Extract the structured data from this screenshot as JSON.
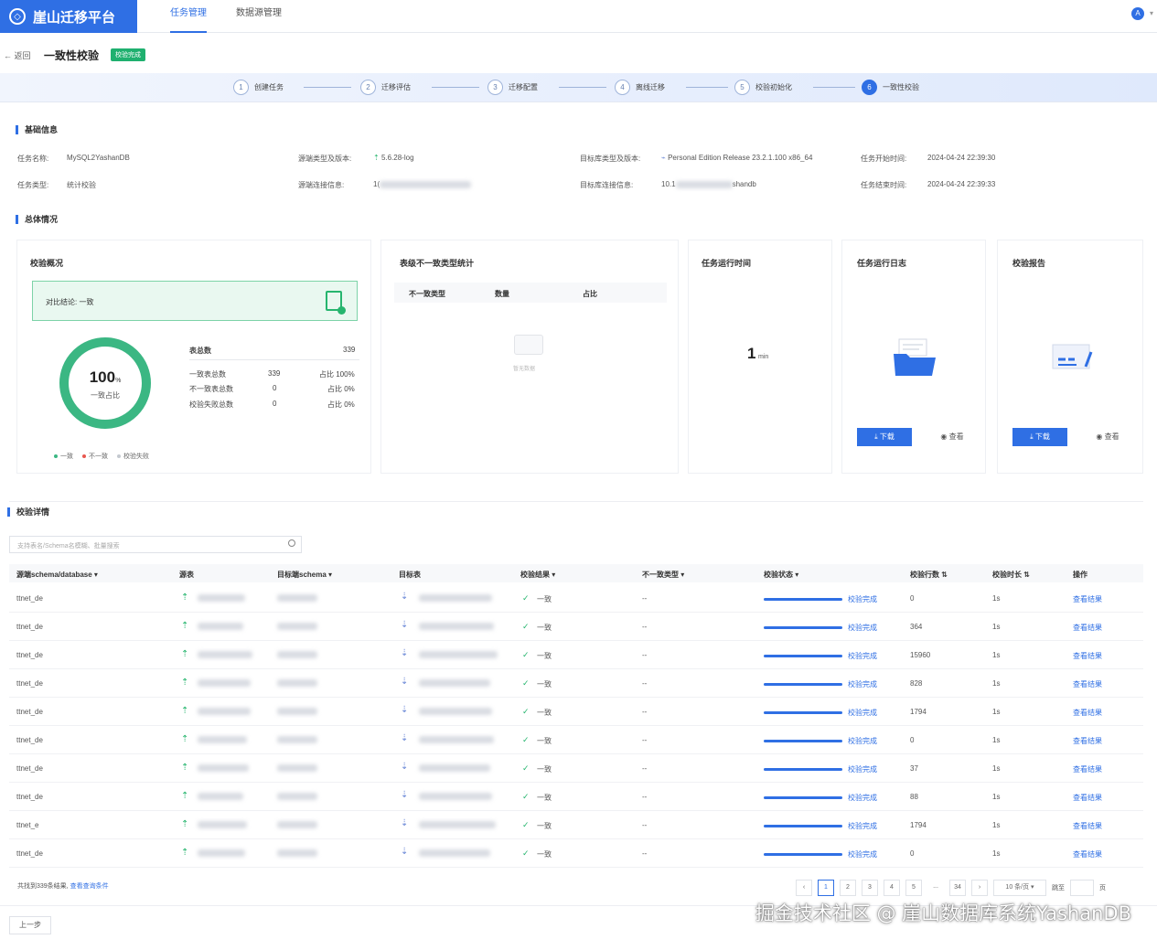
{
  "header": {
    "brand": "崖山迁移平台",
    "tabs": [
      "任务管理",
      "数据源管理"
    ],
    "avatar_letter": "A"
  },
  "subheader": {
    "back_label": "返回",
    "title": "一致性校验",
    "status": "校验完成"
  },
  "steps": [
    {
      "num": "1",
      "label": "创建任务"
    },
    {
      "num": "2",
      "label": "迁移评估"
    },
    {
      "num": "3",
      "label": "迁移配置"
    },
    {
      "num": "4",
      "label": "离线迁移"
    },
    {
      "num": "5",
      "label": "校验初始化"
    },
    {
      "num": "6",
      "label": "一致性校验"
    }
  ],
  "basic_info": {
    "title": "基础信息",
    "task_name_label": "任务名称:",
    "task_name": "MySQL2YashanDB",
    "task_type_label": "任务类型:",
    "task_type": "统计校验",
    "src_type_label": "源端类型及版本:",
    "src_version": "5.6.28-log",
    "src_conn_label": "源端连接信息:",
    "src_conn_prefix": "1(",
    "tgt_type_label": "目标库类型及版本:",
    "tgt_version": "Personal Edition Release 23.2.1.100 x86_64",
    "tgt_conn_label": "目标库连接信息:",
    "tgt_conn_prefix": "10.1",
    "tgt_conn_suffix": "shandb",
    "start_label": "任务开始时间:",
    "start_time": "2024-04-24 22:39:30",
    "end_label": "任务结束时间:",
    "end_time": "2024-04-24 22:39:33"
  },
  "overview": {
    "title": "总体情况",
    "summary_card": {
      "title": "校验概况",
      "conclusion": "对比结论: 一致",
      "percent": "100",
      "percent_unit": "%",
      "percent_label": "一致占比",
      "total_label": "表总数",
      "total": "339",
      "rows": [
        {
          "label": "一致表总数",
          "value": "339",
          "ratio": "占比 100%"
        },
        {
          "label": "不一致表总数",
          "value": "0",
          "ratio": "占比 0%"
        },
        {
          "label": "校验失败总数",
          "value": "0",
          "ratio": "占比 0%"
        }
      ],
      "legend": [
        "一致",
        "不一致",
        "校验失败"
      ],
      "consistent_fraction": 1.0
    },
    "inconsistency_card": {
      "title": "表级不一致类型统计",
      "columns": [
        "不一致类型",
        "数量",
        "占比"
      ],
      "empty": "暂无数据"
    },
    "runtime_card": {
      "title": "任务运行时间",
      "value": "1",
      "unit": "min"
    },
    "log_card": {
      "title": "任务运行日志",
      "download": "下载",
      "view": "查看"
    },
    "report_card": {
      "title": "校验报告",
      "download": "下载",
      "view": "查看"
    }
  },
  "details": {
    "title": "校验详情",
    "search_placeholder": "支持表名/Schema名模糊、批量搜索",
    "columns": [
      "源端schema/database",
      "源表",
      "目标端schema",
      "目标表",
      "校验结果",
      "不一致类型",
      "校验状态",
      "校验行数",
      "校验时长",
      "操作"
    ],
    "rows": [
      {
        "schema": "ttnet_de",
        "result": "一致",
        "type": "--",
        "status": "校验完成",
        "rows": "0",
        "time": "1s",
        "action": "查看结果"
      },
      {
        "schema": "ttnet_de",
        "result": "一致",
        "type": "--",
        "status": "校验完成",
        "rows": "364",
        "time": "1s",
        "action": "查看结果"
      },
      {
        "schema": "ttnet_de",
        "result": "一致",
        "type": "--",
        "status": "校验完成",
        "rows": "15960",
        "time": "1s",
        "action": "查看结果"
      },
      {
        "schema": "ttnet_de",
        "result": "一致",
        "type": "--",
        "status": "校验完成",
        "rows": "828",
        "time": "1s",
        "action": "查看结果"
      },
      {
        "schema": "ttnet_de",
        "result": "一致",
        "type": "--",
        "status": "校验完成",
        "rows": "1794",
        "time": "1s",
        "action": "查看结果"
      },
      {
        "schema": "ttnet_de",
        "result": "一致",
        "type": "--",
        "status": "校验完成",
        "rows": "0",
        "time": "1s",
        "action": "查看结果"
      },
      {
        "schema": "ttnet_de",
        "result": "一致",
        "type": "--",
        "status": "校验完成",
        "rows": "37",
        "time": "1s",
        "action": "查看结果"
      },
      {
        "schema": "ttnet_de",
        "result": "一致",
        "type": "--",
        "status": "校验完成",
        "rows": "88",
        "time": "1s",
        "action": "查看结果"
      },
      {
        "schema": "ttnet_e",
        "result": "一致",
        "type": "--",
        "status": "校验完成",
        "rows": "1794",
        "time": "1s",
        "action": "查看结果"
      },
      {
        "schema": "ttnet_de",
        "result": "一致",
        "type": "--",
        "status": "校验完成",
        "rows": "0",
        "time": "1s",
        "action": "查看结果"
      }
    ],
    "footer_text": "共找到339条结果,",
    "footer_link": "查看查询条件",
    "pages": [
      "1",
      "2",
      "3",
      "4",
      "5",
      "...",
      "34"
    ],
    "page_size": "10 条/页",
    "goto_label": "跳至",
    "goto_suffix": "页",
    "prev_step": "上一步"
  },
  "watermark": "掘金技术社区 @ 崖山数据库系统YashanDB",
  "colors": {
    "primary": "#2f6fe4",
    "success": "#26b56e"
  }
}
